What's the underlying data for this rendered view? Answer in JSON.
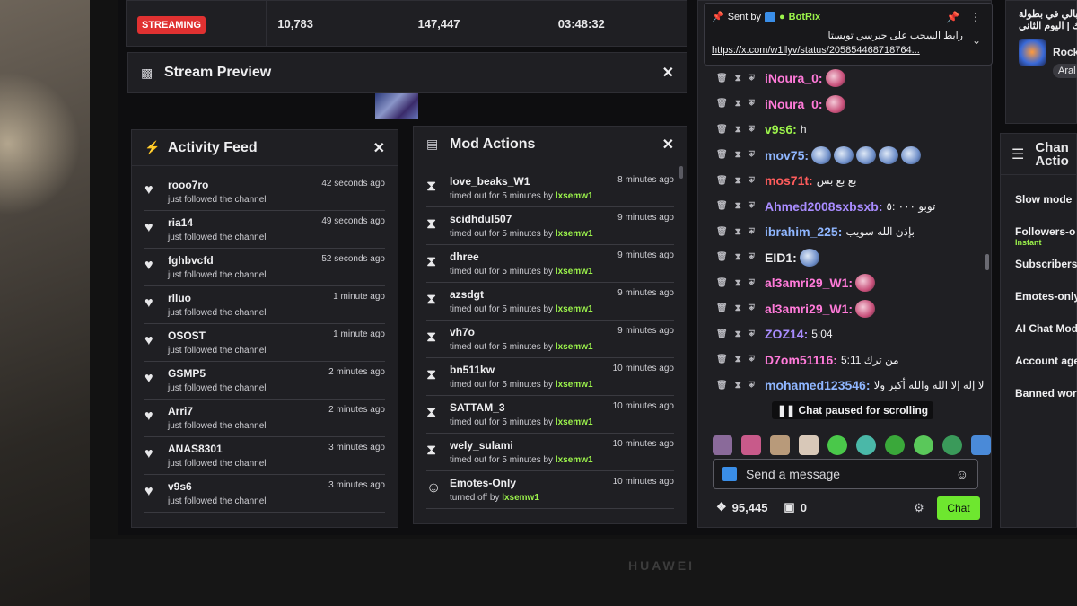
{
  "device": {
    "brand": "HUAWEI"
  },
  "stats": {
    "status_badge": "STREAMING",
    "viewers": "10,783",
    "followers": "147,447",
    "uptime": "03:48:32"
  },
  "preview": {
    "title": "Stream Preview"
  },
  "activity": {
    "title": "Activity Feed",
    "items": [
      {
        "name": "rooo7ro",
        "action": "just followed the channel",
        "time": "42 seconds ago"
      },
      {
        "name": "ria14",
        "action": "just followed the channel",
        "time": "49 seconds ago"
      },
      {
        "name": "fghbvcfd",
        "action": "just followed the channel",
        "time": "52 seconds ago"
      },
      {
        "name": "rlluo",
        "action": "just followed the channel",
        "time": "1 minute ago"
      },
      {
        "name": "OSOST",
        "action": "just followed the channel",
        "time": "1 minute ago"
      },
      {
        "name": "GSMP5",
        "action": "just followed the channel",
        "time": "2 minutes ago"
      },
      {
        "name": "Arri7",
        "action": "just followed the channel",
        "time": "2 minutes ago"
      },
      {
        "name": "ANAS8301",
        "action": "just followed the channel",
        "time": "3 minutes ago"
      },
      {
        "name": "v9s6",
        "action": "just followed the channel",
        "time": "3 minutes ago"
      }
    ]
  },
  "mod_actions": {
    "title": "Mod Actions",
    "items": [
      {
        "icon": "hourglass-icon",
        "name": "love_beaks_W1",
        "action": "timed out for 5 minutes by",
        "mod": "lxsemw1",
        "time": "8 minutes ago"
      },
      {
        "icon": "hourglass-icon",
        "name": "scidhdul507",
        "action": "timed out for 5 minutes by",
        "mod": "lxsemw1",
        "time": "9 minutes ago"
      },
      {
        "icon": "hourglass-icon",
        "name": "dhree",
        "action": "timed out for 5 minutes by",
        "mod": "lxsemw1",
        "time": "9 minutes ago"
      },
      {
        "icon": "hourglass-icon",
        "name": "azsdgt",
        "action": "timed out for 5 minutes by",
        "mod": "lxsemw1",
        "time": "9 minutes ago"
      },
      {
        "icon": "hourglass-icon",
        "name": "vh7o",
        "action": "timed out for 5 minutes by",
        "mod": "lxsemw1",
        "time": "9 minutes ago"
      },
      {
        "icon": "hourglass-icon",
        "name": "bn511kw",
        "action": "timed out for 5 minutes by",
        "mod": "lxsemw1",
        "time": "10 minutes ago"
      },
      {
        "icon": "hourglass-icon",
        "name": "SATTAM_3",
        "action": "timed out for 5 minutes by",
        "mod": "lxsemw1",
        "time": "10 minutes ago"
      },
      {
        "icon": "hourglass-icon",
        "name": "wely_sulami",
        "action": "timed out for 5 minutes by",
        "mod": "lxsemw1",
        "time": "10 minutes ago"
      },
      {
        "icon": "smiley-icon",
        "name": "Emotes-Only",
        "action": "turned off by",
        "mod": "lxsemw1",
        "time": "10 minutes ago"
      }
    ]
  },
  "chat": {
    "pinned": {
      "sent_by": "Sent by",
      "bot": "BotRix",
      "message": "رابط السحب على جيرسي تويستا",
      "link": "https://x.com/w1llyv/status/205854468718764..."
    },
    "messages": [
      {
        "user": "iNoura_0:",
        "color": "#ff7ad9",
        "text": "",
        "emotes": 1
      },
      {
        "user": "iNoura_0:",
        "color": "#ff7ad9",
        "text": "",
        "emotes": 1
      },
      {
        "user": "v9s6:",
        "color": "#9bf24b",
        "text": "h",
        "emotes": 0
      },
      {
        "user": "mov75:",
        "color": "#8fb6ff",
        "text": "",
        "emotes": 5
      },
      {
        "user": "mos71t:",
        "color": "#ff5c5c",
        "text": "بع بع بس",
        "emotes": 0
      },
      {
        "user": "Ahmed2008sxbsxb:",
        "color": "#a98cff",
        "text": "توبو ٠٠٠ :٥",
        "emotes": 0
      },
      {
        "user": "ibrahim_225:",
        "color": "#8fb6ff",
        "text": "بإذن الله سويب",
        "emotes": 0
      },
      {
        "user": "EID1:",
        "color": "#efeff1",
        "text": "",
        "emotes": 1
      },
      {
        "user": "al3amri29_W1:",
        "color": "#ff7ad9",
        "text": "",
        "emotes": 1
      },
      {
        "user": "al3amri29_W1:",
        "color": "#ff7ad9",
        "text": "",
        "emotes": 1
      },
      {
        "user": "ZOZ14:",
        "color": "#a98cff",
        "text": "5:04",
        "emotes": 0
      },
      {
        "user": "D7om51116:",
        "color": "#ff7ad9",
        "text": "5:11 من ترك",
        "emotes": 0
      },
      {
        "user": "mohamed123546:",
        "color": "#8fb6ff",
        "text": "لا إله إلا الله والله أكبر ولا",
        "emotes": 0
      }
    ],
    "paused_label": "Chat paused for scrolling",
    "input_placeholder": "Send a message",
    "bits": "95,445",
    "points": "0",
    "chat_button": "Chat"
  },
  "right_panel": {
    "top_line1": "تبالي في بطولة",
    "top_line2": "ك | اليوم الثاني",
    "game": "Rock",
    "tag": "Aral",
    "chan_title1": "Chan",
    "chan_title2": "Actio",
    "settings": [
      {
        "label": "Slow mode",
        "sub": ""
      },
      {
        "label": "Followers-o",
        "sub": "Instant"
      },
      {
        "label": "Subscribers",
        "sub": ""
      },
      {
        "label": "Emotes-only",
        "sub": ""
      },
      {
        "label": "AI Chat Mod",
        "sub": ""
      },
      {
        "label": "Account age",
        "sub": ""
      },
      {
        "label": "Banned word",
        "sub": ""
      }
    ]
  }
}
